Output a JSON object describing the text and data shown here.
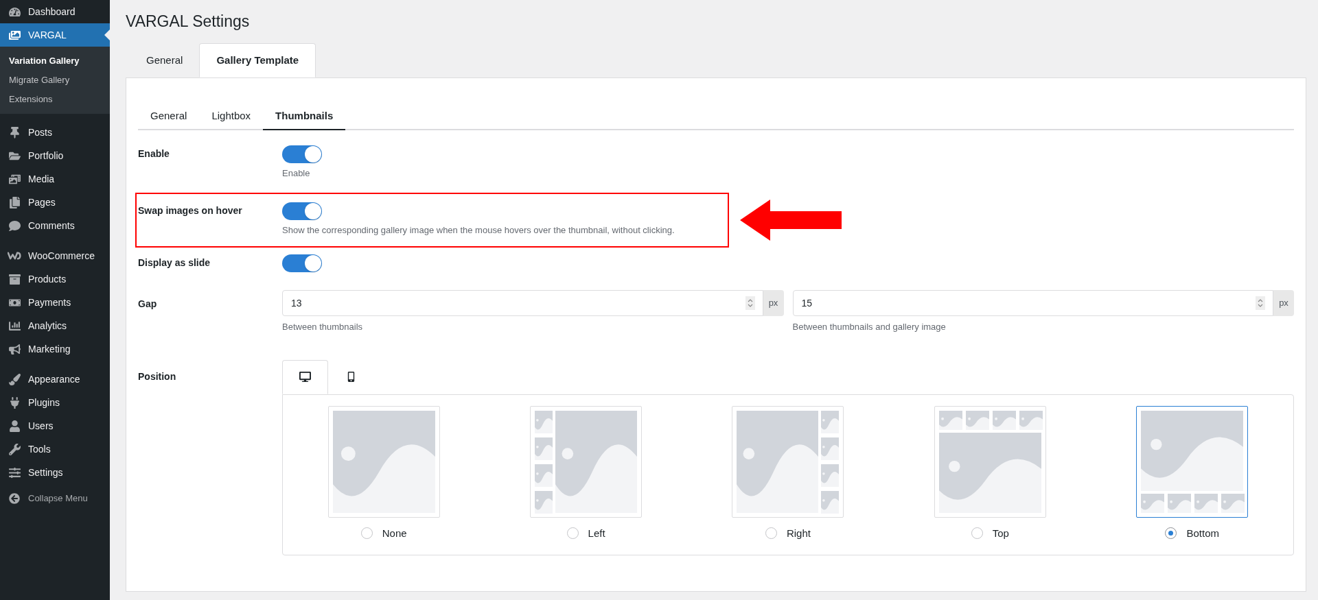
{
  "sidebar": {
    "groups": [
      [
        {
          "label": "Dashboard",
          "selected": false
        },
        {
          "label": "VARGAL",
          "selected": true,
          "children": [
            {
              "label": "Variation Gallery",
              "selected": true
            },
            {
              "label": "Migrate Gallery",
              "selected": false
            },
            {
              "label": "Extensions",
              "selected": false
            }
          ]
        }
      ],
      [
        {
          "label": "Posts",
          "selected": false
        },
        {
          "label": "Portfolio",
          "selected": false
        },
        {
          "label": "Media",
          "selected": false
        },
        {
          "label": "Pages",
          "selected": false
        },
        {
          "label": "Comments",
          "selected": false
        }
      ],
      [
        {
          "label": "WooCommerce",
          "selected": false
        },
        {
          "label": "Products",
          "selected": false
        },
        {
          "label": "Payments",
          "selected": false
        },
        {
          "label": "Analytics",
          "selected": false
        },
        {
          "label": "Marketing",
          "selected": false
        }
      ],
      [
        {
          "label": "Appearance",
          "selected": false
        },
        {
          "label": "Plugins",
          "selected": false
        },
        {
          "label": "Users",
          "selected": false
        },
        {
          "label": "Tools",
          "selected": false
        },
        {
          "label": "Settings",
          "selected": false
        }
      ]
    ],
    "collapse_menu": {
      "label": "Collapse Menu"
    }
  },
  "page": {
    "title": "VARGAL Settings",
    "tabs": [
      {
        "label": "General",
        "selected": false
      },
      {
        "label": "Gallery Template",
        "selected": true
      }
    ],
    "subtabs": [
      {
        "label": "General",
        "selected": false
      },
      {
        "label": "Lightbox",
        "selected": false
      },
      {
        "label": "Thumbnails",
        "selected": true
      }
    ],
    "settings": [
      {
        "kind": "toggle",
        "label": "Enable",
        "on": true,
        "description": "Enable"
      },
      {
        "kind": "toggle",
        "label": "Swap images on hover",
        "on": true,
        "description": "Show the corresponding gallery image when the mouse hovers over the thumbnail, without clicking.",
        "highlighted": true
      },
      {
        "kind": "toggle",
        "label": "Display as slide",
        "on": true
      },
      {
        "kind": "number_pair",
        "label": "Gap",
        "fields": [
          {
            "value": "13",
            "unit": "px",
            "description": "Between thumbnails"
          },
          {
            "value": "15",
            "unit": "px",
            "description": "Between thumbnails and gallery image"
          }
        ]
      },
      {
        "kind": "position",
        "label": "Position",
        "devices": [
          {
            "kind": "desktop",
            "selected": true
          },
          {
            "kind": "mobile",
            "selected": false
          }
        ],
        "layouts": [
          {
            "kind": "none",
            "label": "None",
            "selected": false
          },
          {
            "kind": "left",
            "label": "Left",
            "selected": false
          },
          {
            "kind": "right",
            "label": "Right",
            "selected": false
          },
          {
            "kind": "top",
            "label": "Top",
            "selected": false
          },
          {
            "kind": "bottom",
            "label": "Bottom",
            "selected": true
          }
        ]
      }
    ]
  }
}
